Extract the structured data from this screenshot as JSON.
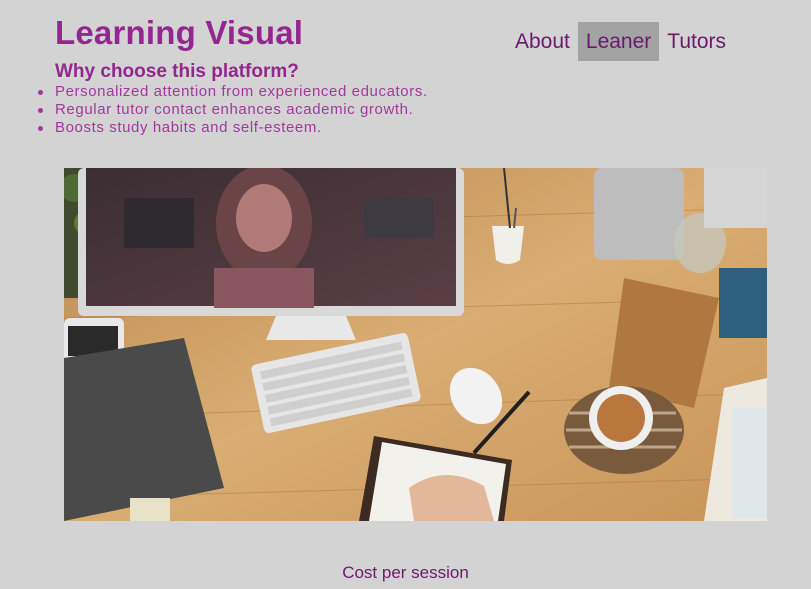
{
  "brand": {
    "title": "Learning Visual"
  },
  "nav": {
    "items": [
      "About",
      "Leaner",
      "Tutors"
    ],
    "active": "Leaner"
  },
  "why": {
    "heading": "Why choose this platform?",
    "points": [
      "Personalized attention from experienced educators.",
      "Regular tutor contact enhances academic growth.",
      "Boosts study habits and self-esteem."
    ]
  },
  "footer": {
    "cost_label": "Cost per session"
  },
  "colors": {
    "background": "#d3d3d3",
    "brand_purple": "#93278f",
    "nav_text": "#6b1a6b",
    "nav_active_bg": "#a3a3a3"
  }
}
